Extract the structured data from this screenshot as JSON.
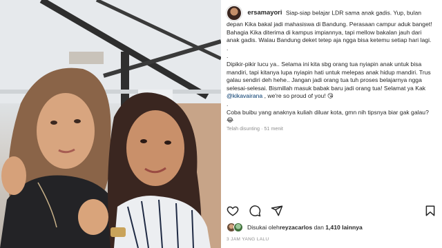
{
  "post": {
    "username": "ersamayori",
    "caption": {
      "p1": "Siap-siap belajar LDR sama anak gadis. Yup, bulan depan Kika bakal jadi mahasiswa di Bandung. Perasaan campur aduk banget! Bahagia Kika diterima di kampus impiannya, tapi mellow bakalan jauh dari anak gadis. Walau Bandung deket tetep aja ngga bisa ketemu setiap hari lagi.",
      "dot1": ".",
      "dot2": ".",
      "p2a": "Dipikir-pikir lucu ya.. Selama ini kita sbg orang tua nyiapin anak untuk bisa mandiri, tapi kitanya lupa nyiapin hati untuk melepas anak hidup mandiri. Trus galau sendiri deh hehe.. Jangan jadi orang tua tuh proses belajarnya ngga selesai-selesai. Bismillah masuk babak baru jadi orang tua! Selamat ya Kak ",
      "mention": "@kikavairana",
      "p2b": " , we're so proud of you! 😘",
      "dot3": ".",
      "p3": "Coba buibu yang anaknya kuliah diluar kota, gmn nih tipsnya biar gak galau? 😂"
    },
    "edited_label": "Telah disunting · 51 menit",
    "likes": {
      "prefix": "Disukai oleh ",
      "user": "reyzacarlos",
      "middle": " dan ",
      "count": "1,410 lainnya"
    },
    "timestamp": "3 JAM YANG LALU"
  },
  "icons": {
    "like": "heart-icon",
    "comment": "comment-icon",
    "share": "share-icon",
    "save": "bookmark-icon"
  },
  "colors": {
    "text": "#262626",
    "muted": "#8e8e8e",
    "mention": "#00376b"
  }
}
